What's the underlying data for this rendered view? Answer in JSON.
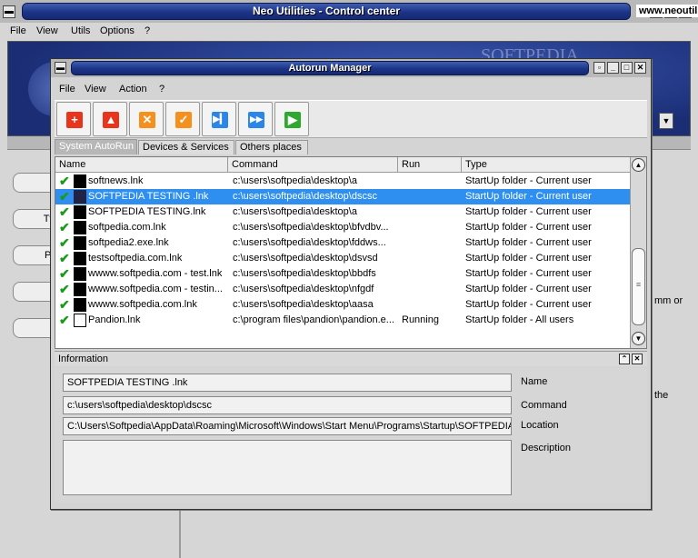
{
  "main_window": {
    "title": "Neo Utilities - Control center",
    "menu": [
      "File",
      "View",
      "Utils",
      "Options",
      "?"
    ],
    "banner_url": "www.neoutils.ru",
    "watermark": "SOFTPEDIA",
    "bg_text_1": "mm or",
    "bg_text_2": "the",
    "side_buttons": [
      "",
      "Tv",
      "Pr",
      "",
      ""
    ]
  },
  "dialog": {
    "title": "Autorun Manager",
    "menu": [
      "File",
      "View",
      "Action",
      "?"
    ],
    "toolbar": [
      {
        "icon": "add-icon",
        "color": "#e8341c"
      },
      {
        "icon": "up-icon",
        "color": "#e8341c"
      },
      {
        "icon": "delete-icon",
        "color": "#f5901e"
      },
      {
        "icon": "check-icon",
        "color": "#f5901e"
      },
      {
        "icon": "step-forward-icon",
        "color": "#2b86e8"
      },
      {
        "icon": "fast-forward-icon",
        "color": "#2b86e8"
      },
      {
        "icon": "play-icon",
        "color": "#2ea82e"
      }
    ],
    "tabs": [
      "System AutoRun",
      "Devices & Services",
      "Others places"
    ],
    "columns": [
      "Name",
      "Command",
      "Run",
      "Type"
    ],
    "rows": [
      {
        "name": "softnews.lnk",
        "command": "c:\\users\\softpedia\\desktop\\a",
        "run": "",
        "type": "StartUp folder - Current user"
      },
      {
        "name": "SOFTPEDIA TESTING .lnk",
        "command": "c:\\users\\softpedia\\desktop\\dscsc",
        "run": "",
        "type": "StartUp folder - Current user"
      },
      {
        "name": "SOFTPEDIA TESTING.lnk",
        "command": "c:\\users\\softpedia\\desktop\\a",
        "run": "",
        "type": "StartUp folder - Current user"
      },
      {
        "name": "softpedia.com.lnk",
        "command": "c:\\users\\softpedia\\desktop\\bfvdbv...",
        "run": "",
        "type": "StartUp folder - Current user"
      },
      {
        "name": "softpedia2.exe.lnk",
        "command": "c:\\users\\softpedia\\desktop\\fddws...",
        "run": "",
        "type": "StartUp folder - Current user"
      },
      {
        "name": "testsoftpedia.com.lnk",
        "command": "c:\\users\\softpedia\\desktop\\dsvsd",
        "run": "",
        "type": "StartUp folder - Current user"
      },
      {
        "name": "wwww.softpedia.com - test.lnk",
        "command": "c:\\users\\softpedia\\desktop\\bbdfs",
        "run": "",
        "type": "StartUp folder - Current user"
      },
      {
        "name": "wwww.softpedia.com - testin...",
        "command": "c:\\users\\softpedia\\desktop\\nfgdf",
        "run": "",
        "type": "StartUp folder - Current user"
      },
      {
        "name": "wwww.softpedia.com.lnk",
        "command": "c:\\users\\softpedia\\desktop\\aasa",
        "run": "",
        "type": "StartUp folder - Current user"
      },
      {
        "name": "Pandion.lnk",
        "command": "c:\\program files\\pandion\\pandion.e...",
        "run": "Running",
        "type": "StartUp folder - All users"
      }
    ],
    "selected_row": 1,
    "info": {
      "header": "Information",
      "name_value": "SOFTPEDIA TESTING .lnk",
      "command_value": "c:\\users\\softpedia\\desktop\\dscsc",
      "location_value": "C:\\Users\\Softpedia\\AppData\\Roaming\\Microsoft\\Windows\\Start Menu\\Programs\\Startup\\SOFTPEDIA T",
      "description_value": "",
      "name_label": "Name",
      "command_label": "Command",
      "location_label": "Location",
      "description_label": "Description"
    }
  }
}
